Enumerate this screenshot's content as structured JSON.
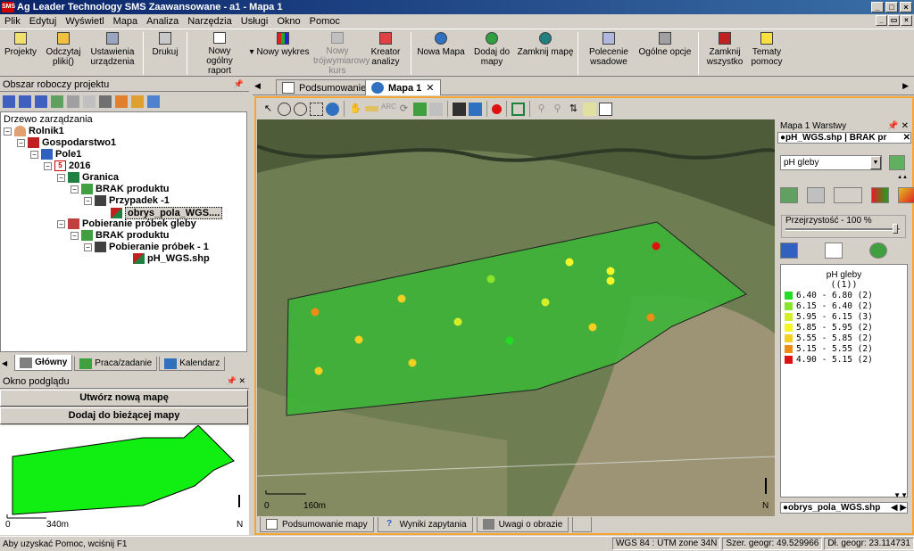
{
  "window": {
    "title": "Ag Leader Technology SMS Zaawansowane - a1 - Mapa 1",
    "app_badge": "SMS"
  },
  "menu": [
    "Plik",
    "Edytuj",
    "Wyświetl",
    "Mapa",
    "Analiza",
    "Narzędzia",
    "Usługi",
    "Okno",
    "Pomoc"
  ],
  "toolbar": {
    "projects": "Projekty",
    "read_files": "Odczytaj pliki()",
    "device_settings": "Ustawienia urządzenia",
    "print": "Drukuj",
    "new_report": "Nowy ogólny raport",
    "new_chart": "Nowy wykres",
    "new_3d": "Nowy trójwymiarowy kurs",
    "analysis_wizard": "Kreator analizy",
    "new_map": "Nowa Mapa",
    "add_to_map": "Dodaj do mapy",
    "close_map": "Zamknij mapę",
    "batch_command": "Polecenie wsadowe",
    "general_options": "Ogólne opcje",
    "close_all": "Zamknij wszystko",
    "help_topics": "Tematy pomocy"
  },
  "left_panel": {
    "title": "Obszar roboczy projektu",
    "tree_label": "Drzewo zarządzania",
    "tree": {
      "grower": "Rolnik1",
      "farm": "Gospodarstwo1",
      "field": "Pole1",
      "year": "2016",
      "boundary": "Granica",
      "no_product_1": "BRAK produktu",
      "case": "Przypadek -1",
      "boundary_file": "obrys_pola_WGS....",
      "soil_sampling": "Pobieranie próbek gleby",
      "no_product_2": "BRAK produktu",
      "sampling_1": "Pobieranie próbek - 1",
      "ph_file": "pH_WGS.shp",
      "year_badge": "5"
    },
    "tabs": [
      "Główny",
      "Praca/zadanie",
      "Kalendarz"
    ]
  },
  "preview_panel": {
    "title": "Okno podglądu",
    "create_map_btn": "Utwórz nową mapę",
    "add_map_btn": "Dodaj do bieżącej mapy",
    "scale_label": "340m",
    "north": "N",
    "scale_zero": "0"
  },
  "doc_tabs": [
    "Podsumowanie",
    "Mapa 1"
  ],
  "map": {
    "scale_label": "160m",
    "scale_zero": "0",
    "north": "N",
    "bottom_tabs": [
      "Podsumowanie mapy",
      "Wyniki zapytania",
      "Uwagi o obrazie"
    ]
  },
  "layers_panel": {
    "title": "Mapa 1 Warstwy",
    "top_tab": "pH_WGS.shp | BRAK pr",
    "selected_attr": "pH gleby",
    "transparency": "Przejrzystość - 100 %",
    "bottom_tab": "obrys_pola_WGS.shp"
  },
  "legend": {
    "title": "pH gleby",
    "subtitle": "((1))",
    "entries": [
      {
        "range": "6.40 - 6.80",
        "count": "(2)",
        "color": "#22dd22"
      },
      {
        "range": "6.15 - 6.40",
        "count": "(2)",
        "color": "#88e62a"
      },
      {
        "range": "5.95 - 6.15",
        "count": "(3)",
        "color": "#d4ee2a"
      },
      {
        "range": "5.85 - 5.95",
        "count": "(2)",
        "color": "#f6f626"
      },
      {
        "range": "5.55 - 5.85",
        "count": "(2)",
        "color": "#f2cf20"
      },
      {
        "range": "5.15 - 5.55",
        "count": "(2)",
        "color": "#ee8d16"
      },
      {
        "range": "4.90 - 5.15",
        "count": "(2)",
        "color": "#dd1111"
      }
    ]
  },
  "statusbar": {
    "hint": "Aby uzyskać Pomoc, wciśnij F1",
    "projection": "WGS 84 : UTM zone 34N",
    "lat": "Szer. geogr: 49.529966",
    "lon": "Dł. geogr: 23.114731"
  }
}
